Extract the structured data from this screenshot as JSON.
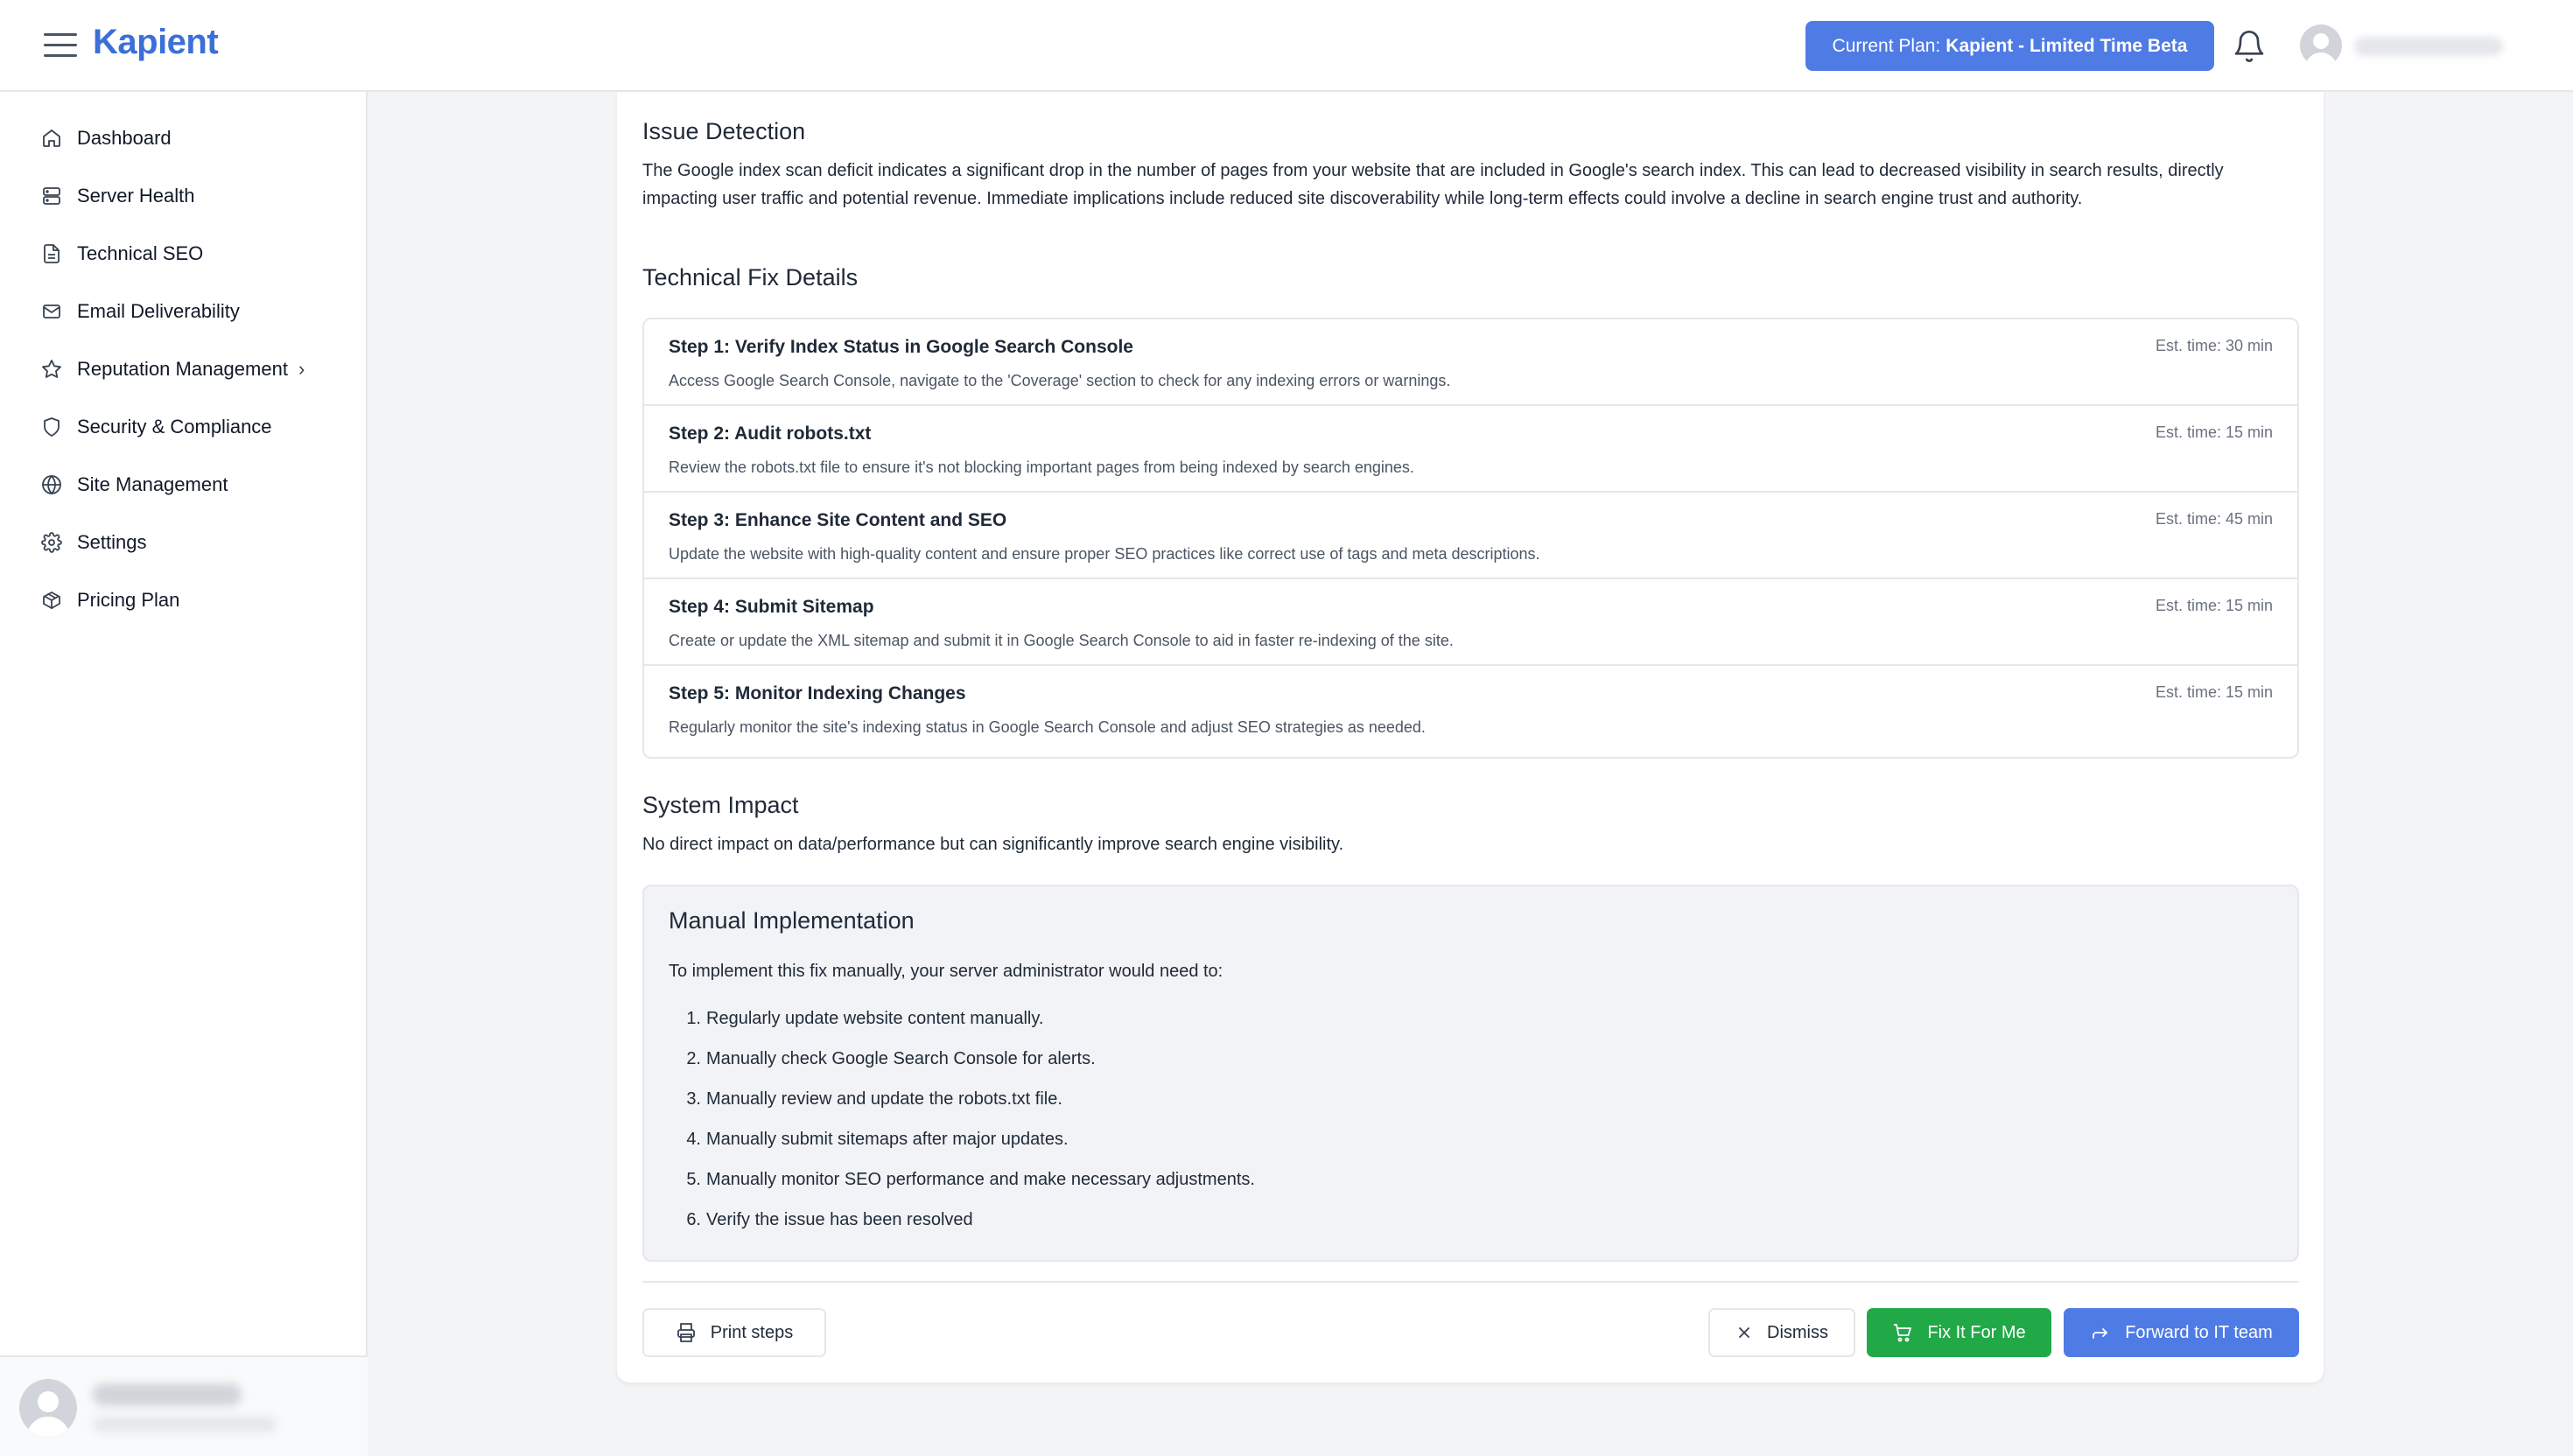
{
  "app": {
    "name": "Kapient"
  },
  "header": {
    "plan_label": "Current Plan:",
    "plan_name": "Kapient - Limited Time Beta"
  },
  "sidebar": {
    "items": [
      {
        "label": "Dashboard",
        "icon": "home-icon"
      },
      {
        "label": "Server Health",
        "icon": "server-icon"
      },
      {
        "label": "Technical SEO",
        "icon": "document-icon"
      },
      {
        "label": "Email Deliverability",
        "icon": "mail-icon"
      },
      {
        "label": "Reputation Management",
        "icon": "star-icon"
      },
      {
        "label": "Security & Compliance",
        "icon": "shield-icon"
      },
      {
        "label": "Site Management",
        "icon": "globe-icon"
      },
      {
        "label": "Settings",
        "icon": "gear-icon"
      },
      {
        "label": "Pricing Plan",
        "icon": "package-icon"
      }
    ]
  },
  "main": {
    "issue_heading": "Issue Detection",
    "issue_text": "The Google index scan deficit indicates a significant drop in the number of pages from your website that are included in Google's search index. This can lead to decreased visibility in search results, directly impacting user traffic and potential revenue. Immediate implications include reduced site discoverability while long-term effects could involve a decline in search engine trust and authority.",
    "fix_heading": "Technical Fix Details",
    "steps": [
      {
        "title": "Step 1: Verify Index Status in Google Search Console",
        "time": "Est. time: 30 min",
        "desc": "Access Google Search Console, navigate to the 'Coverage' section to check for any indexing errors or warnings."
      },
      {
        "title": "Step 2: Audit robots.txt",
        "time": "Est. time: 15 min",
        "desc": "Review the robots.txt file to ensure it's not blocking important pages from being indexed by search engines."
      },
      {
        "title": "Step 3: Enhance Site Content and SEO",
        "time": "Est. time: 45 min",
        "desc": "Update the website with high-quality content and ensure proper SEO practices like correct use of tags and meta descriptions."
      },
      {
        "title": "Step 4: Submit Sitemap",
        "time": "Est. time: 15 min",
        "desc": "Create or update the XML sitemap and submit it in Google Search Console to aid in faster re-indexing of the site."
      },
      {
        "title": "Step 5: Monitor Indexing Changes",
        "time": "Est. time: 15 min",
        "desc": "Regularly monitor the site's indexing status in Google Search Console and adjust SEO strategies as needed."
      }
    ],
    "impact_heading": "System Impact",
    "impact_text": "No direct impact on data/performance but can significantly improve search engine visibility.",
    "manual": {
      "heading": "Manual Implementation",
      "intro": "To implement this fix manually, your server administrator would need to:",
      "items": [
        "Regularly update website content manually.",
        "Manually check Google Search Console for alerts.",
        "Manually review and update the robots.txt file.",
        "Manually submit sitemaps after major updates.",
        "Manually monitor SEO performance and make necessary adjustments.",
        "Verify the issue has been resolved"
      ]
    },
    "actions": {
      "print": "Print steps",
      "dismiss": "Dismiss",
      "fix": "Fix It For Me",
      "forward": "Forward to IT team"
    }
  },
  "colors": {
    "brand": "#3b6fd9",
    "primary_button": "#4f7be5",
    "success_button": "#22a947"
  }
}
